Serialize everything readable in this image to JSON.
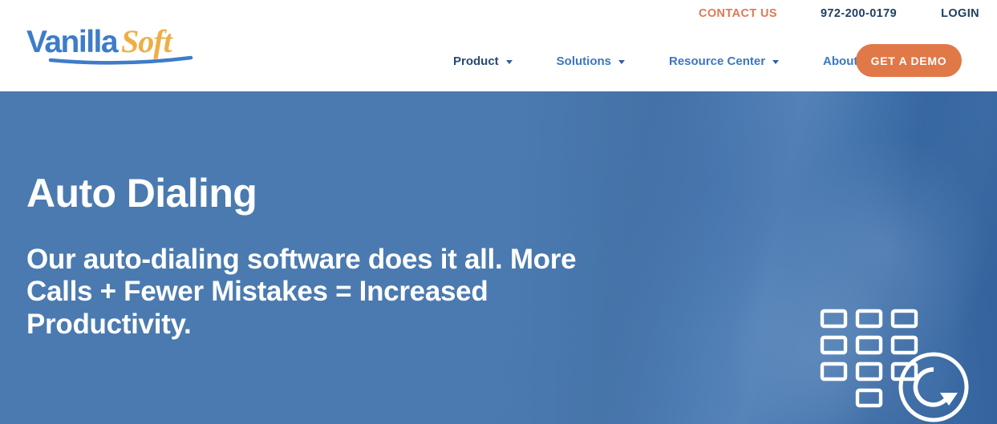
{
  "header": {
    "logo": {
      "name_part1": "Vanilla",
      "name_part2": "Soft",
      "alt": "VanillaSoft"
    },
    "topbar": {
      "contact_label": "CONTACT US",
      "phone": "972-200-0179",
      "login_label": "LOGIN"
    },
    "nav": [
      {
        "label": "Product",
        "has_dropdown": true,
        "active": true
      },
      {
        "label": "Solutions",
        "has_dropdown": true,
        "active": false
      },
      {
        "label": "Resource Center",
        "has_dropdown": true,
        "active": false
      },
      {
        "label": "About",
        "has_dropdown": true,
        "active": false
      }
    ],
    "cta": {
      "label": "GET A DEMO"
    }
  },
  "hero": {
    "title": "Auto Dialing",
    "subtitle": "Our auto-dialing software does it all. More Calls + Fewer Mistakes = Increased Productivity.",
    "graphic": {
      "name": "dialpad-redial-icon",
      "keys": 10,
      "badge": "refresh-icon"
    }
  },
  "colors": {
    "brand_blue": "#3a77c4",
    "brand_dark_blue": "#1e3f63",
    "brand_orange": "#e07848",
    "contact_orange": "#dd7a55",
    "logo_gold": "#eeae45",
    "hero_blue": "#4a78ae",
    "white": "#ffffff"
  }
}
